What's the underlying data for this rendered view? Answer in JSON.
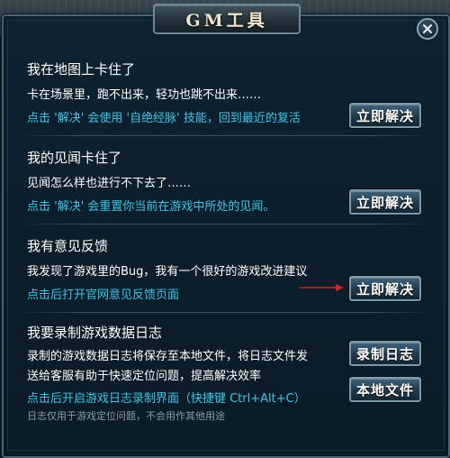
{
  "window": {
    "title": "GM工具"
  },
  "sections": [
    {
      "title": "我在地图上卡住了",
      "description": "卡在场景里，跑不出来，轻功也跳不出来……",
      "hint": "点击 '解决' 会使用 '自绝经脉' 技能，回到最近的复活",
      "button_label": "立即解决"
    },
    {
      "title": "我的见闻卡住了",
      "description": "见闻怎么样也进行不下去了……",
      "hint": "点击 '解决' 会重置你当前在游戏中所处的见闻。",
      "button_label": "立即解决"
    },
    {
      "title": "我有意见反馈",
      "description": "我发现了游戏里的Bug，我有一个很好的游戏改进建议",
      "hint": "点击后打开官网意见反馈页面",
      "button_label": "立即解决"
    },
    {
      "title": "我要录制游戏数据日志",
      "description_line1": "录制的游戏数据日志将保存至本地文件，将日志文件发",
      "description_line2": "送给客服有助于快速定位问题，提高解决效率",
      "hint": "点击后开启游戏日志录制界面（快捷键 Ctrl+Alt+C）",
      "note": "日志仅用于游戏定位问题，不会用作其他用途",
      "record_button_label": "录制日志",
      "local_file_button_label": "本地文件"
    }
  ],
  "colors": {
    "hint": "#3fc6e8",
    "annotation_arrow": "#e02020",
    "panel": "#0d1a24"
  },
  "icons": {
    "close": "close-icon"
  }
}
